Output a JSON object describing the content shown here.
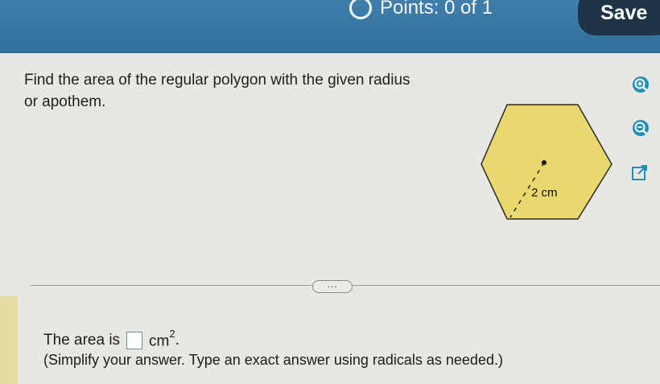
{
  "header": {
    "points_label": "Points: 0 of 1",
    "save_label": "Save"
  },
  "question": {
    "prompt": "Find the area of the regular polygon with the given radius or apothem."
  },
  "figure": {
    "shape": "hexagon",
    "fill_color": "#e8d86d",
    "measure_label": "2 cm"
  },
  "toolbar": {
    "zoom_in_icon": "zoom-in-icon",
    "zoom_out_icon": "zoom-out-icon",
    "popout_icon": "popout-icon"
  },
  "more_label": "...",
  "answer": {
    "prefix": "The area is",
    "input_value": "",
    "unit": "cm",
    "exponent": "2",
    "suffix": ".",
    "hint": "(Simplify your answer. Type an exact answer using radicals as needed.)"
  },
  "colors": {
    "header": "#3a7aa6",
    "save_button": "#1f3346",
    "hexagon": "#e8d86d"
  }
}
